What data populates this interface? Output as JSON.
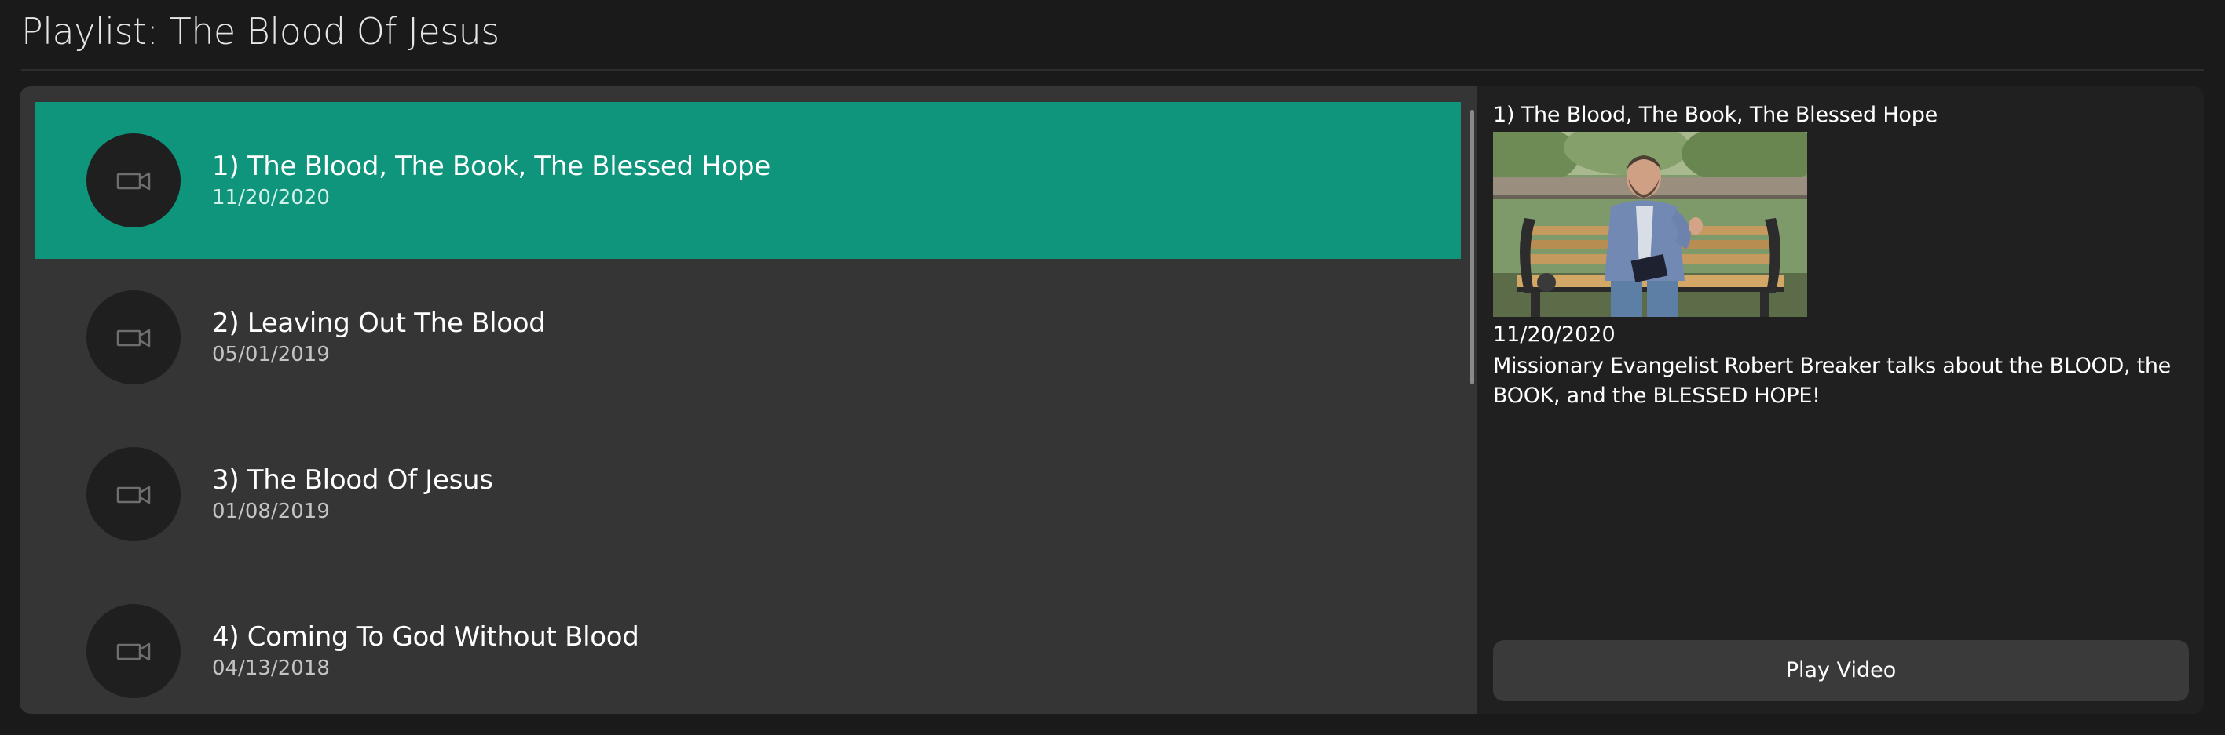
{
  "page": {
    "title": "Playlist: The Blood Of Jesus"
  },
  "playlist": {
    "items": [
      {
        "title": "1) The Blood, The Book, The Blessed Hope",
        "date": "11/20/2020",
        "selected": true,
        "icon": "video-camera-icon"
      },
      {
        "title": "2) Leaving Out The Blood",
        "date": "05/01/2019",
        "selected": false,
        "icon": "video-camera-icon"
      },
      {
        "title": "3) The Blood Of Jesus",
        "date": "01/08/2019",
        "selected": false,
        "icon": "video-camera-icon"
      },
      {
        "title": "4) Coming To God Without Blood",
        "date": "04/13/2018",
        "selected": false,
        "icon": "video-camera-icon"
      }
    ]
  },
  "detail": {
    "title": "1) The Blood, The Book, The Blessed Hope",
    "date": "11/20/2020",
    "description": "Missionary Evangelist Robert Breaker talks about the BLOOD, the BOOK, and the BLESSED HOPE!",
    "play_label": "Play Video"
  },
  "colors": {
    "background": "#1a1a1a",
    "list_background": "#353535",
    "detail_background": "#202020",
    "selected_accent": "#0e957c",
    "button_background": "#3a3a3a"
  }
}
